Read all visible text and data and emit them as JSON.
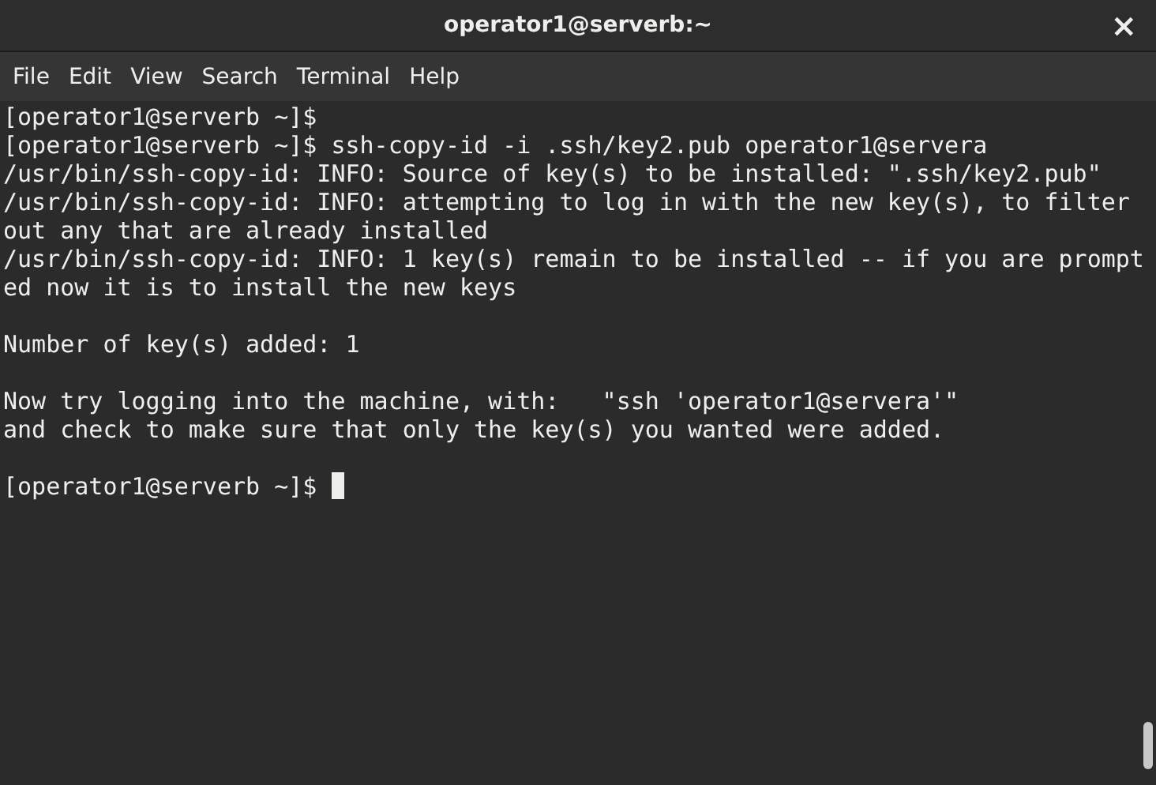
{
  "window": {
    "title": "operator1@serverb:~",
    "close": "×"
  },
  "menu": [
    "File",
    "Edit",
    "View",
    "Search",
    "Terminal",
    "Help"
  ],
  "terminal": {
    "lines": [
      {
        "kind": "text",
        "text": "[operator1@serverb ~]$"
      },
      {
        "kind": "text",
        "text": "[operator1@serverb ~]$ ssh-copy-id -i .ssh/key2.pub operator1@servera"
      },
      {
        "kind": "text",
        "text": "/usr/bin/ssh-copy-id: INFO: Source of key(s) to be installed: \".ssh/key2.pub\""
      },
      {
        "kind": "text",
        "text": "/usr/bin/ssh-copy-id: INFO: attempting to log in with the new key(s), to filter"
      },
      {
        "kind": "text",
        "text": "out any that are already installed"
      },
      {
        "kind": "text",
        "text": "/usr/bin/ssh-copy-id: INFO: 1 key(s) remain to be installed -- if you are prompt"
      },
      {
        "kind": "text",
        "text": "ed now it is to install the new keys"
      },
      {
        "kind": "blank"
      },
      {
        "kind": "text",
        "text": "Number of key(s) added: 1"
      },
      {
        "kind": "blank"
      },
      {
        "kind": "text",
        "text": "Now try logging into the machine, with:   \"ssh 'operator1@servera'\""
      },
      {
        "kind": "text",
        "text": "and check to make sure that only the key(s) you wanted were added."
      },
      {
        "kind": "blank"
      },
      {
        "kind": "prompt",
        "text": "[operator1@serverb ~]$ ",
        "cursor": true
      }
    ]
  }
}
